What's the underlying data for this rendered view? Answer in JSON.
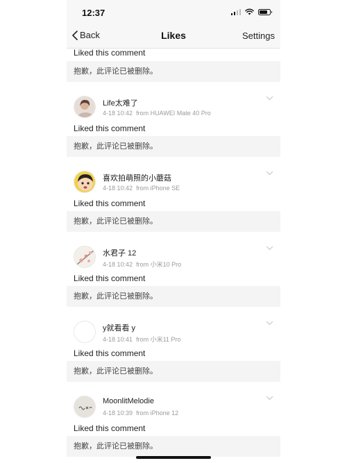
{
  "status_bar": {
    "time": "12:37"
  },
  "nav": {
    "back_label": "Back",
    "title": "Likes",
    "settings_label": "Settings"
  },
  "first_card": {
    "liked_text": "Liked this comment",
    "quote": "抱歉，此评论已被删除。"
  },
  "items": [
    {
      "username": "Life太难了",
      "time": "4-18 10:42",
      "source": "from HUAWEI Mate 40 Pro",
      "liked_text": "Liked this comment",
      "quote": "抱歉，此评论已被删除。",
      "avatar_icon": "woman-portrait-icon"
    },
    {
      "username": "喜欢拍萌照的小蘑菇",
      "time": "4-18 10:42",
      "source": "from iPhone SE",
      "liked_text": "Liked this comment",
      "quote": "抱歉，此评论已被删除。",
      "avatar_icon": "cartoon-child-icon"
    },
    {
      "username": "水君子 12",
      "time": "4-18 10:42",
      "source": "from 小米10 Pro",
      "liked_text": "Liked this comment",
      "quote": "抱歉，此评论已被删除。",
      "avatar_icon": "blossom-icon"
    },
    {
      "username": "y就看看 y",
      "time": "4-18 10:41",
      "source": "from 小米11 Pro",
      "liked_text": "Liked this comment",
      "quote": "抱歉，此评论已被删除。",
      "avatar_icon": "blank-avatar-icon"
    },
    {
      "username": "MoonlitMelodie",
      "time": "4-18 10:39",
      "source": "from iPhone 12",
      "liked_text": "Liked this comment",
      "quote": "抱歉，此评论已被删除。",
      "avatar_icon": "handwriting-avatar-icon"
    }
  ],
  "colors": {
    "background": "#efefef",
    "card": "#ffffff",
    "quote_bg": "#f4f4f4",
    "meta_text": "#9a9a9a"
  }
}
